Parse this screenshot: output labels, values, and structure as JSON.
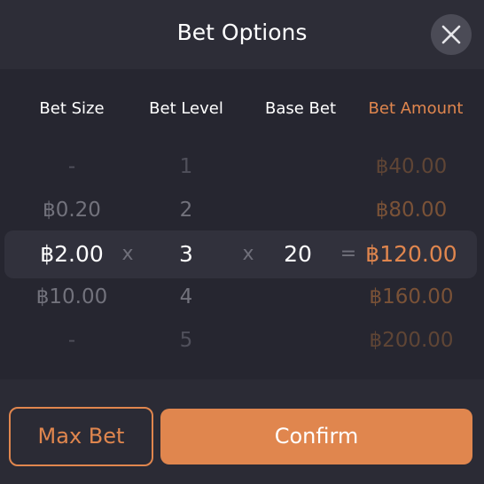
{
  "dialog": {
    "title": "Bet Options",
    "close_icon": "close-icon"
  },
  "columns": {
    "bet_size": "Bet Size",
    "bet_level": "Bet Level",
    "base_bet": "Base Bet",
    "bet_amount": "Bet Amount"
  },
  "rows": [
    {
      "size": "-",
      "level": "1",
      "amount": "฿40.00"
    },
    {
      "size": "฿0.20",
      "level": "2",
      "amount": "฿80.00"
    },
    {
      "size": "฿2.00",
      "level": "3",
      "base": "20",
      "amount": "฿120.00"
    },
    {
      "size": "฿10.00",
      "level": "4",
      "amount": "฿160.00"
    },
    {
      "size": "-",
      "level": "5",
      "amount": "฿200.00"
    }
  ],
  "operators": {
    "multiply": "x",
    "equals": "="
  },
  "buttons": {
    "max_bet": "Max Bet",
    "confirm": "Confirm"
  },
  "colors": {
    "accent": "#e0864e",
    "background": "#2b2b35",
    "panel": "#262630",
    "selected_row": "#31313c"
  }
}
